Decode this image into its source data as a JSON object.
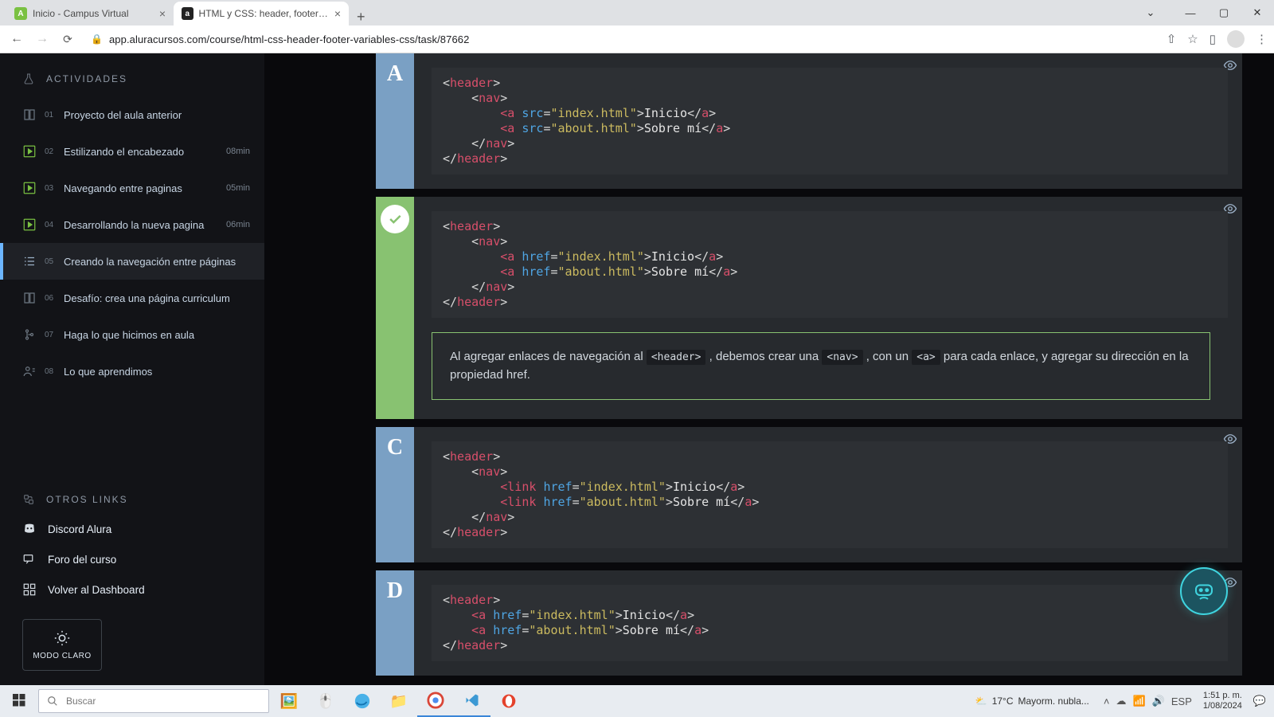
{
  "browser": {
    "tabs": [
      {
        "title": "Inicio - Campus Virtual",
        "fav_bg": "#7ac142",
        "fav_tx": "A",
        "fav_col": "#fff"
      },
      {
        "title": "HTML y CSS: header, footer y var",
        "fav_bg": "#222",
        "fav_tx": "a",
        "fav_col": "#fff"
      }
    ],
    "url": "app.aluracursos.com/course/html-css-header-footer-variables-css/task/87662"
  },
  "sidebar": {
    "activities_label": "ACTIVIDADES",
    "items": [
      {
        "num": "01",
        "label": "Proyecto del aula anterior",
        "dur": "",
        "icon": "book"
      },
      {
        "num": "02",
        "label": "Estilizando el encabezado",
        "dur": "08min",
        "icon": "play"
      },
      {
        "num": "03",
        "label": "Navegando entre paginas",
        "dur": "05min",
        "icon": "play"
      },
      {
        "num": "04",
        "label": "Desarrollando la nueva pagina",
        "dur": "06min",
        "icon": "play"
      },
      {
        "num": "05",
        "label": "Creando la navegación entre páginas",
        "dur": "",
        "icon": "list"
      },
      {
        "num": "06",
        "label": "Desafío: crea una página curriculum",
        "dur": "",
        "icon": "book"
      },
      {
        "num": "07",
        "label": "Haga lo que hicimos en aula",
        "dur": "",
        "icon": "code"
      },
      {
        "num": "08",
        "label": "Lo que aprendimos",
        "dur": "",
        "icon": "user"
      }
    ],
    "other_label": "OTROS LINKS",
    "other": [
      {
        "label": "Discord Alura",
        "icon": "discord"
      },
      {
        "label": "Foro del curso",
        "icon": "forum"
      },
      {
        "label": "Volver al Dashboard",
        "icon": "dash"
      }
    ],
    "mode_label": "MODO CLARO"
  },
  "options": {
    "a": {
      "letter": "A"
    },
    "b": {},
    "c": {
      "letter": "C"
    },
    "d": {
      "letter": "D"
    },
    "explain_pre": "Al agregar enlaces de navegación al ",
    "explain_c1": "<header>",
    "explain_mid1": " , debemos crear una ",
    "explain_c2": "<nav>",
    "explain_mid2": " , con un ",
    "explain_c3": "<a>",
    "explain_post": "  para cada enlace, y agregar su dirección en la propiedad href."
  },
  "code_a": {
    "l1": [
      "<header>"
    ],
    "l2": [
      "    <nav>"
    ],
    "l3": [
      "        <a ",
      "src",
      "=",
      "\"index.html\"",
      ">",
      "Inicio",
      "</a>"
    ],
    "l4": [
      "        <a ",
      "src",
      "=",
      "\"about.html\"",
      ">",
      "Sobre mí",
      "</a>"
    ],
    "l5": [
      "    </nav>"
    ],
    "l6": [
      "</header>"
    ]
  },
  "code_b": {
    "l1": [
      "<header>"
    ],
    "l2": [
      "    <nav>"
    ],
    "l3": [
      "        <a ",
      "href",
      "=",
      "\"index.html\"",
      ">",
      "Inicio",
      "</a>"
    ],
    "l4": [
      "        <a ",
      "href",
      "=",
      "\"about.html\"",
      ">",
      "Sobre mí",
      "</a>"
    ],
    "l5": [
      "    </nav>"
    ],
    "l6": [
      "</header>"
    ]
  },
  "code_c": {
    "l1": [
      "<header>"
    ],
    "l2": [
      "    <nav>"
    ],
    "l3": [
      "        <link ",
      "href",
      "=",
      "\"index.html\"",
      ">",
      "Inicio",
      "</a>"
    ],
    "l4": [
      "        <link ",
      "href",
      "=",
      "\"about.html\"",
      ">",
      "Sobre mí",
      "</a>"
    ],
    "l5": [
      "    </nav>"
    ],
    "l6": [
      "</header>"
    ]
  },
  "code_d": {
    "l1": [
      "<header>"
    ],
    "l2": [
      "    <a ",
      "href",
      "=",
      "\"index.html\"",
      ">",
      "Inicio",
      "</a>"
    ],
    "l3": [
      "    <a ",
      "href",
      "=",
      "\"about.html\"",
      ">",
      "Sobre mí",
      "</a>"
    ],
    "l4": [
      "</header>"
    ]
  },
  "taskbar": {
    "search_placeholder": "Buscar",
    "weather_temp": "17°C",
    "weather_desc": "Mayorm. nubla...",
    "lang": "ESP",
    "time": "1:51 p. m.",
    "date": "1/08/2024"
  }
}
